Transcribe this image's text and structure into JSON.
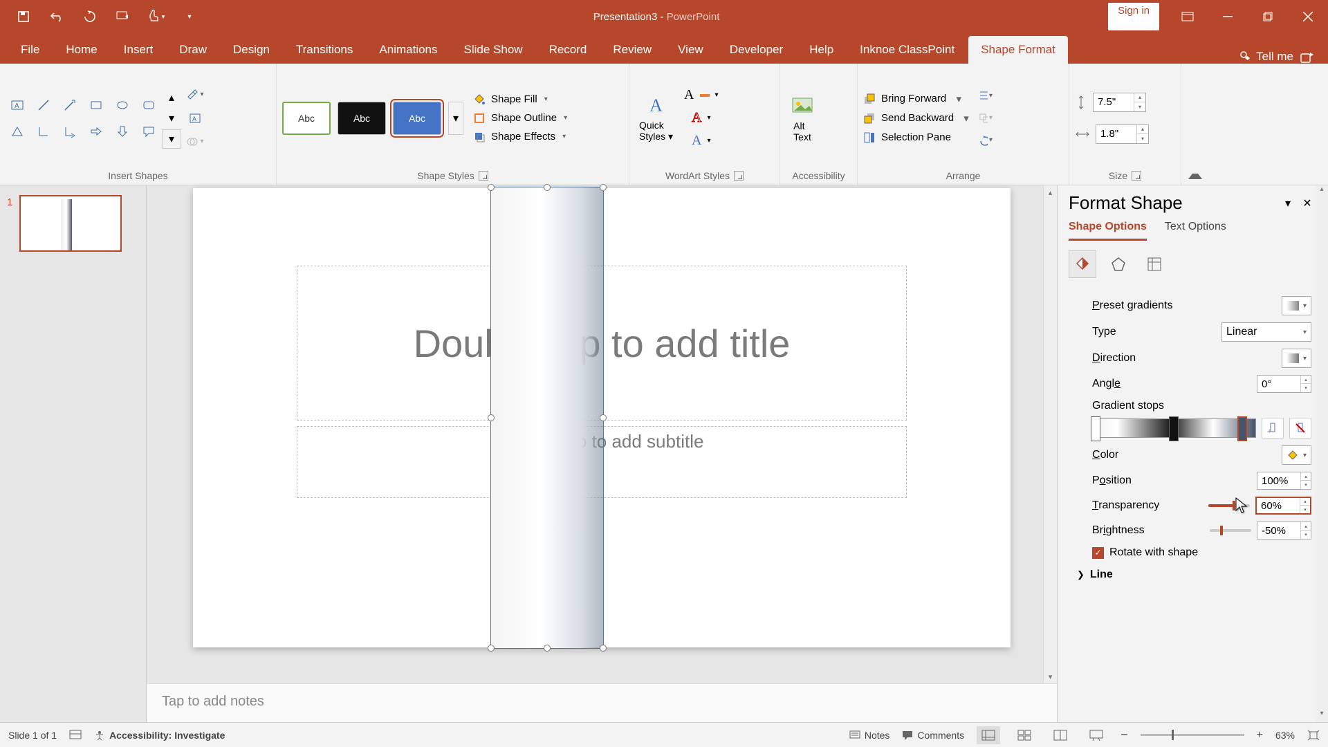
{
  "titlebar": {
    "doc": "Presentation3",
    "sep": " - ",
    "app": "PowerPoint",
    "signin": "Sign in"
  },
  "tabs": {
    "file": "File",
    "home": "Home",
    "insert": "Insert",
    "draw": "Draw",
    "design": "Design",
    "transitions": "Transitions",
    "animations": "Animations",
    "slideshow": "Slide Show",
    "record": "Record",
    "review": "Review",
    "view": "View",
    "developer": "Developer",
    "help": "Help",
    "classpoint": "Inknoe ClassPoint",
    "shapeformat": "Shape Format",
    "tellme": "Tell me"
  },
  "ribbon": {
    "insert_shapes": "Insert Shapes",
    "shape_styles": "Shape Styles",
    "wordart_styles": "WordArt Styles",
    "accessibility": "Accessibility",
    "arrange": "Arrange",
    "size": "Size",
    "abc": "Abc",
    "shape_fill": "Shape Fill",
    "shape_outline": "Shape Outline",
    "shape_effects": "Shape Effects",
    "quick_styles": "Quick Styles",
    "alt_text": "Alt Text",
    "bring_forward": "Bring Forward",
    "send_backward": "Send Backward",
    "selection_pane": "Selection Pane",
    "height": "7.5\"",
    "width": "1.8\""
  },
  "slide": {
    "title_ph": "Double tap to add title",
    "subtitle_ph": "Double tap to add subtitle",
    "notes_ph": "Tap to add notes",
    "thumb_num": "1"
  },
  "pane": {
    "title": "Format Shape",
    "shape_options": "Shape Options",
    "text_options": "Text Options",
    "preset_gradients": "Preset gradients",
    "type": "Type",
    "type_val": "Linear",
    "direction": "Direction",
    "angle": "Angle",
    "angle_val": "0°",
    "gradient_stops": "Gradient stops",
    "color": "Color",
    "position": "Position",
    "position_val": "100%",
    "transparency": "Transparency",
    "transparency_val": "60%",
    "brightness": "Brightness",
    "brightness_val": "-50%",
    "rotate": "Rotate with shape",
    "line": "Line"
  },
  "status": {
    "slide_n": "Slide 1 of 1",
    "accessibility": "Accessibility: Investigate",
    "notes": "Notes",
    "comments": "Comments",
    "zoom": "63%"
  }
}
